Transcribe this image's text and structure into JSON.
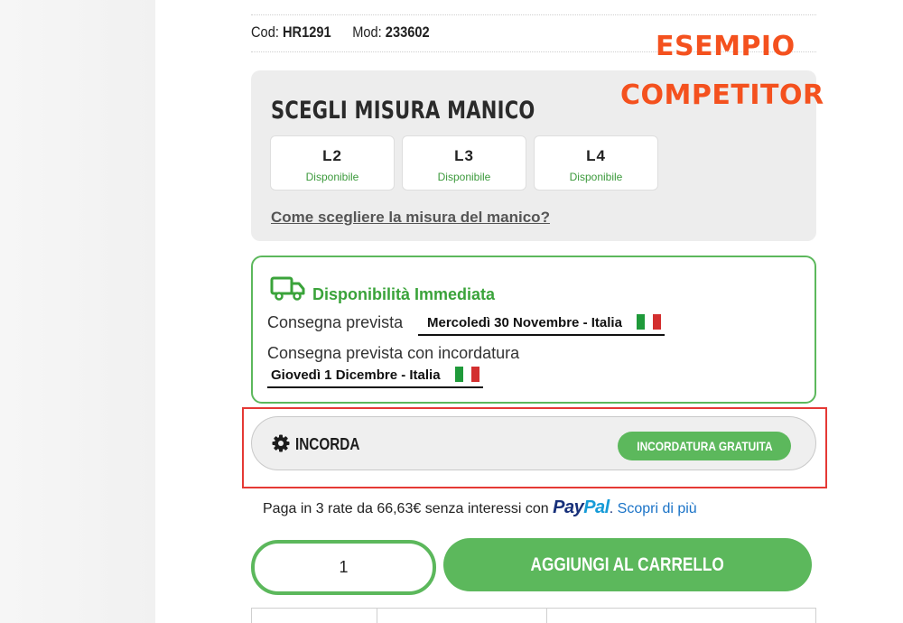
{
  "product_codes": {
    "cod_label": "Cod:",
    "cod_value": "HR1291",
    "mod_label": "Mod:",
    "mod_value": "233602"
  },
  "annotation": {
    "line1": "ESEMPIO",
    "line2": "COMPETITOR"
  },
  "size_selector": {
    "title": "SCEGLI MISURA MANICO",
    "options": [
      {
        "label": "L2",
        "status": "Disponibile"
      },
      {
        "label": "L3",
        "status": "Disponibile"
      },
      {
        "label": "L4",
        "status": "Disponibile"
      }
    ],
    "help_link": "Come scegliere la misura del manico?"
  },
  "availability": {
    "title": "Disponibilità Immediata",
    "delivery_label": "Consegna prevista",
    "delivery_value": "Mercoledì 30 Novembre - Italia",
    "stringing_label": "Consegna prevista con incordatura",
    "stringing_value": "Giovedì 1 Dicembre - Italia",
    "flag_colors": [
      "#1f9a3a",
      "#ffffff",
      "#d32f2f"
    ]
  },
  "stringing": {
    "label": "INCORDA",
    "badge": "INCORDATURA GRATUITA"
  },
  "paypal": {
    "text": "Paga in 3 rate da 66,63€ senza interessi con",
    "logo_part1": "Pay",
    "logo_part2": "Pal",
    "logo_dot": ".",
    "link": "Scopri di più"
  },
  "cart": {
    "quantity": "1",
    "add_button": "AGGIUNGI AL CARRELLO"
  },
  "colors": {
    "accent_green": "#5cb85c",
    "annotation_orange": "#f4511e",
    "highlight_red": "#e53935"
  }
}
